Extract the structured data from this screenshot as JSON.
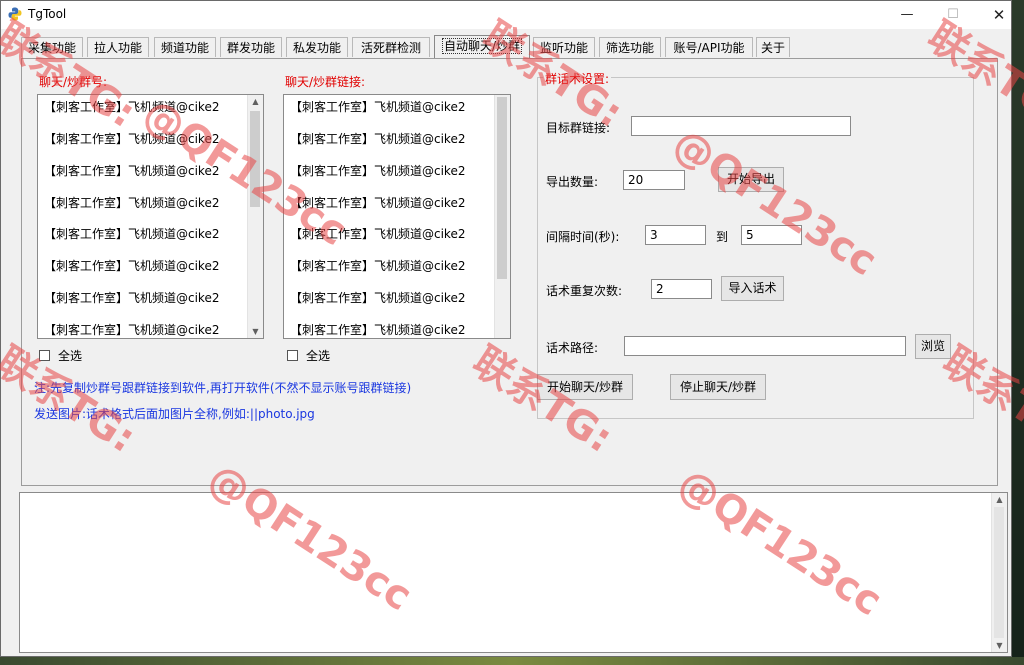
{
  "window": {
    "title": "TgTool",
    "minimize": "—",
    "maximize": "☐",
    "close": "✕"
  },
  "tabs": [
    {
      "label": "采集功能"
    },
    {
      "label": "拉人功能"
    },
    {
      "label": "频道功能"
    },
    {
      "label": "群发功能"
    },
    {
      "label": "私发功能"
    },
    {
      "label": "活死群检测"
    },
    {
      "label": "自动聊天/炒群"
    },
    {
      "label": "监听功能"
    },
    {
      "label": "筛选功能"
    },
    {
      "label": "账号/API功能"
    },
    {
      "label": "关于"
    }
  ],
  "active_tab": "自动聊天/炒群",
  "left_list": {
    "label": "聊天/炒群号:",
    "items": [
      "【刺客工作室】飞机频道@cike2",
      "【刺客工作室】飞机频道@cike2",
      "【刺客工作室】飞机频道@cike2",
      "【刺客工作室】飞机频道@cike2",
      "【刺客工作室】飞机频道@cike2",
      "【刺客工作室】飞机频道@cike2",
      "【刺客工作室】飞机频道@cike2",
      "【刺客工作室】飞机频道@cike2"
    ],
    "select_all": "全选"
  },
  "right_list": {
    "label": "聊天/炒群链接:",
    "items": [
      "【刺客工作室】飞机频道@cike2",
      "【刺客工作室】飞机频道@cike2",
      "【刺客工作室】飞机频道@cike2",
      "【刺客工作室】飞机频道@cike2",
      "【刺客工作室】飞机频道@cike2",
      "【刺客工作室】飞机频道@cike2",
      "【刺客工作室】飞机频道@cike2",
      "【刺客工作室】飞机频道@cike2"
    ],
    "select_all": "全选"
  },
  "notes": {
    "line1": "注:先复制炒群号跟群链接到软件,再打开软件(不然不显示账号跟群链接)",
    "line2": "发送图片:话术格式后面加图片全称,例如:||photo.jpg"
  },
  "settings": {
    "title": "群话术设置:",
    "target_link_label": "目标群链接:",
    "target_link_value": "",
    "export_count_label": "导出数量:",
    "export_count_value": "20",
    "start_export": "开始导出",
    "interval_label": "间隔时间(秒):",
    "interval_from": "3",
    "interval_to_label": "到",
    "interval_to": "5",
    "repeat_label": "话术重复次数:",
    "repeat_value": "2",
    "import_script": "导入话术",
    "path_label": "话术路径:",
    "path_value": "",
    "browse": "浏览"
  },
  "actions": {
    "start": "开始聊天/炒群",
    "stop": "停止聊天/炒群"
  },
  "watermark": {
    "line_a": "联系TG:",
    "line_b": "@QF123cc"
  },
  "colors": {
    "accent_red": "#e10000",
    "note_blue": "#1a37e0",
    "watermark": "#e84646"
  }
}
